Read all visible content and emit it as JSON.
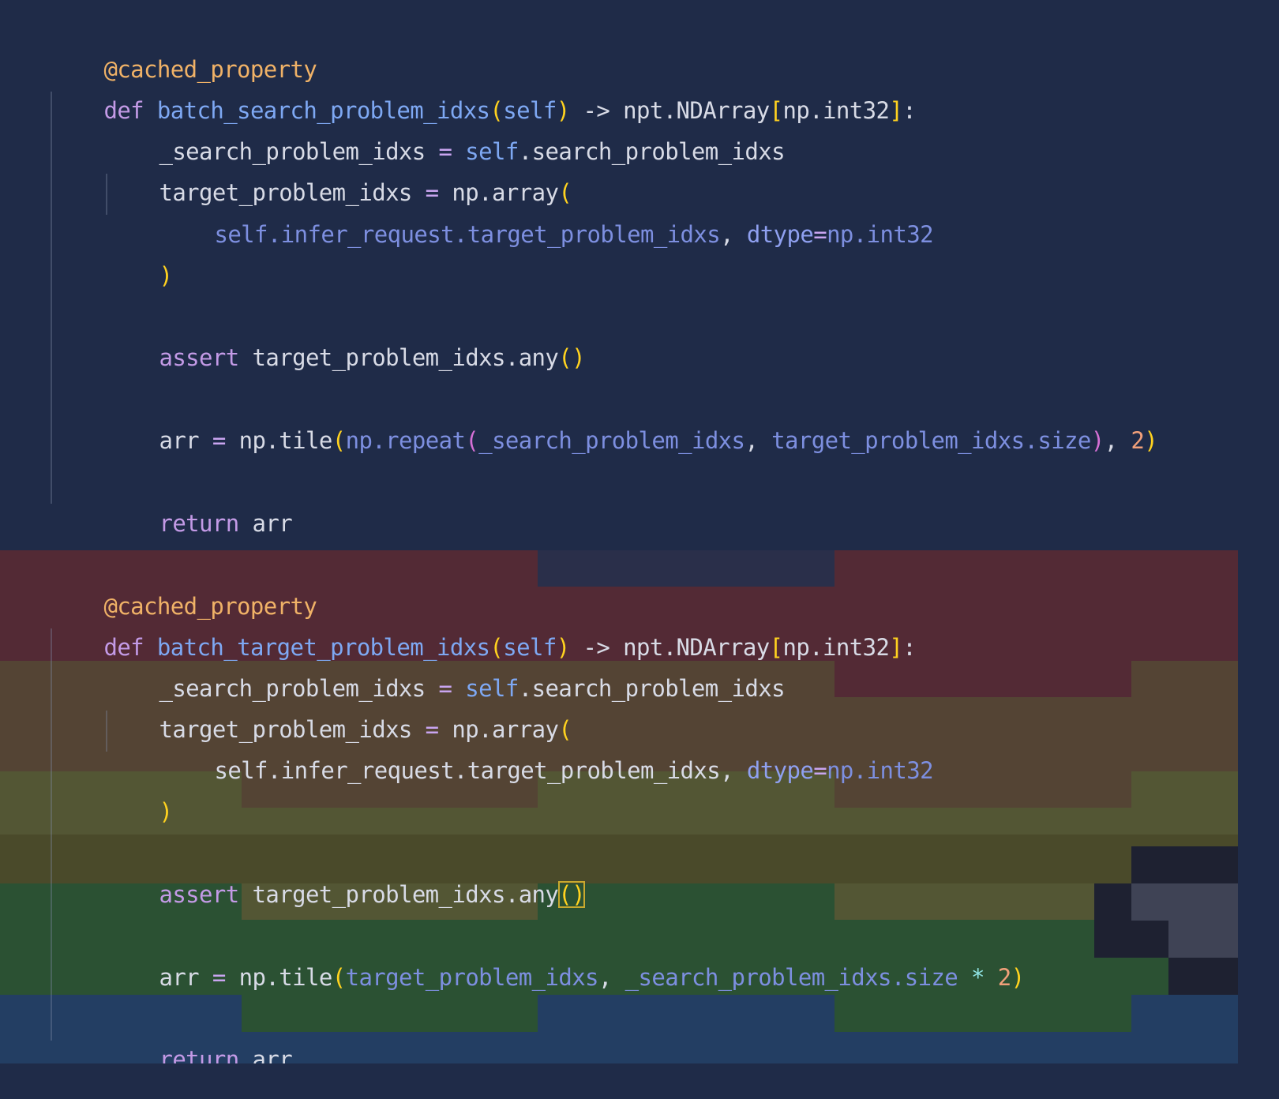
{
  "colors": {
    "editor_background": "#1f2b48",
    "diff_band_red": "#532a35",
    "diff_band_brown": "#544434",
    "diff_band_olive": "#535634",
    "diff_band_current_line": "#4a4a2a",
    "diff_band_green": "#2b5133",
    "diff_band_blue": "#233e63",
    "decorator": "#f0b267",
    "keyword": "#c39ae6",
    "function_name": "#7ea8f3",
    "text": "#d8dbe6",
    "bracket_level1": "#ffd21f",
    "bracket_level2": "#d670d6",
    "number": "#f1a07a"
  },
  "code": {
    "block1": {
      "decorator": "@cached_property",
      "def_kw": "def",
      "fn_name": "batch_search_problem_idxs",
      "self": "self",
      "arrow": "->",
      "ret_type": "npt.NDArray",
      "ret_param": "np.int32",
      "colon": ":",
      "l1_var": "_search_problem_idxs",
      "l1_eq": "=",
      "l1_self": "self",
      "l1_attr": ".search_problem_idxs",
      "l2_var": "target_problem_idxs",
      "l2_eq": "=",
      "l2_call": "np.array",
      "l3_arg": "self.infer_request.target_problem_idxs",
      "l3_comma": ",",
      "l3_kw": "dtype",
      "l3_eq": "=",
      "l3_val": "np.int32",
      "close_paren": ")",
      "assert_kw": "assert",
      "assert_expr": "target_problem_idxs.any",
      "assert_parens": "()",
      "arr_var": "arr",
      "arr_eq": "=",
      "arr_call": "np.tile",
      "arr_inner_call": "np.repeat",
      "arr_arg1": "_search_problem_idxs",
      "arr_arg2": "target_problem_idxs.size",
      "arr_num": "2",
      "return_kw": "return",
      "return_val": "arr"
    },
    "block2": {
      "decorator": "@cached_property",
      "def_kw": "def",
      "fn_name": "batch_target_problem_idxs",
      "self": "self",
      "arrow": "->",
      "ret_type": "npt.NDArray",
      "ret_param": "np.int32",
      "colon": ":",
      "l1_var": "_search_problem_idxs",
      "l1_eq": "=",
      "l1_self": "self",
      "l1_attr": ".search_problem_idxs",
      "l2_var": "target_problem_idxs",
      "l2_eq": "=",
      "l2_call": "np.array",
      "l3_arg": "self.infer_request.target_problem_idxs",
      "l3_comma": ",",
      "l3_kw": "dtype",
      "l3_eq": "=",
      "l3_val": "np.int32",
      "close_paren": ")",
      "assert_kw": "assert",
      "assert_expr": "target_problem_idxs.any",
      "assert_parens": "()",
      "arr_var": "arr",
      "arr_eq": "=",
      "arr_call": "np.tile",
      "arr_arg1": "target_problem_idxs",
      "arr_arg2": "_search_problem_idxs.size",
      "arr_star": "*",
      "arr_num": "2",
      "return_kw": "return",
      "return_val": "arr"
    }
  }
}
